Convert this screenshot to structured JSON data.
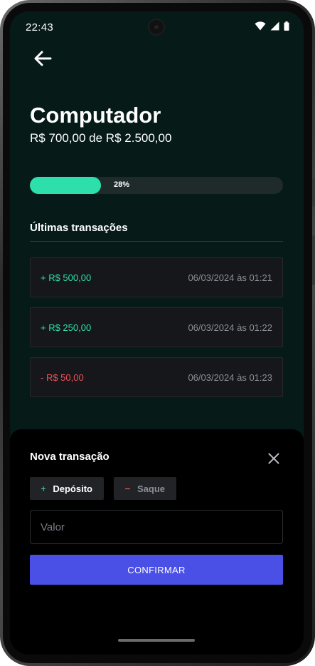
{
  "status_bar": {
    "time": "22:43"
  },
  "header": {
    "title": "Computador",
    "subtitle": "R$ 700,00 de R$ 2.500,00"
  },
  "progress": {
    "value": 0.28,
    "label": "28%"
  },
  "transactions": {
    "title": "Últimas transações",
    "items": [
      {
        "amount": "+ R$ 500,00",
        "date": "06/03/2024 às 01:21",
        "type": "deposit"
      },
      {
        "amount": "+ R$ 250,00",
        "date": "06/03/2024 às 01:22",
        "type": "deposit"
      },
      {
        "amount": "- R$ 50,00",
        "date": "06/03/2024 às 01:23",
        "type": "withdraw"
      }
    ]
  },
  "sheet": {
    "title": "Nova transação",
    "deposit_label": "Depósito",
    "withdraw_label": "Saque",
    "value_placeholder": "Valor",
    "confirm_label": "CONFIRMAR"
  },
  "colors": {
    "accent_green": "#2de0ab",
    "deposit_text": "#2ee0a8",
    "withdraw_text": "#f0505a",
    "confirm_button": "#4a50e6",
    "background": "#061a18"
  },
  "icons": {
    "back": "arrow-left-icon",
    "close": "close-icon",
    "plus": "plus-icon",
    "minus": "minus-icon",
    "wifi": "wifi-icon",
    "signal": "signal-icon",
    "battery": "battery-icon"
  }
}
